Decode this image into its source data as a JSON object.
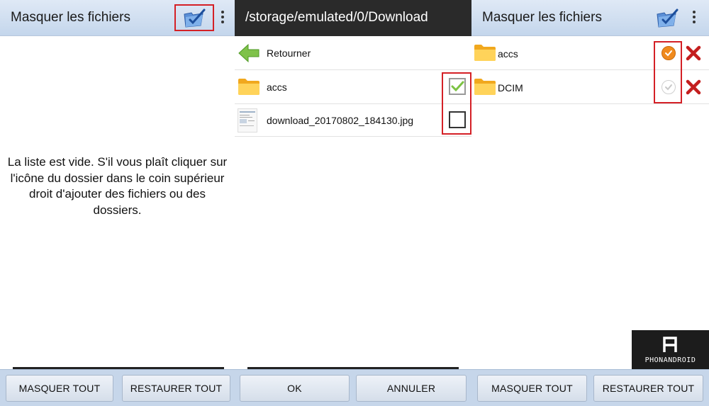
{
  "colors": {
    "appbar": "#c4d6ec",
    "dark_appbar": "#2a2a2a",
    "highlight": "#d42026",
    "bottom_bar": "#c6d6ea",
    "check_green": "#7cc243",
    "check_orange": "#f08a1d",
    "delete_red": "#c41e1e"
  },
  "panel_left": {
    "title": "Masquer les fichiers",
    "icons": [
      "add-folder-icon",
      "overflow-menu-icon"
    ],
    "empty_message": "La liste est vide. S'il vous plaît cliquer sur l'icône du dossier dans le coin supérieur droit d'ajouter des fichiers ou des dossiers.",
    "buttons": {
      "hide_all": "MASQUER TOUT",
      "restore_all": "RESTAURER TOUT"
    }
  },
  "panel_middle": {
    "path": "/storage/emulated/0/Download",
    "back_label": "Retourner",
    "items": [
      {
        "name": "accs",
        "icon": "folder-icon",
        "checked": true
      },
      {
        "name": "download_20170802_184130.jpg",
        "icon": "image-thumbnail-icon",
        "checked": false
      }
    ],
    "buttons": {
      "ok": "OK",
      "cancel": "ANNULER"
    }
  },
  "panel_right": {
    "title": "Masquer les fichiers",
    "items": [
      {
        "name": "accs",
        "icon": "folder-icon",
        "hidden": true
      },
      {
        "name": "DCIM",
        "icon": "folder-icon",
        "hidden": false
      }
    ],
    "buttons": {
      "hide_all": "MASQUER TOUT",
      "restore_all": "RESTAURER TOUT"
    }
  },
  "watermark": {
    "text": "PHONANDROID"
  }
}
